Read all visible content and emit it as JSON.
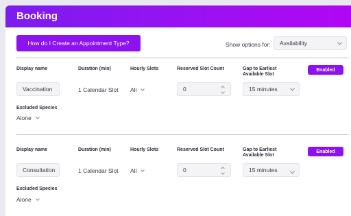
{
  "header": {
    "title": "Booking"
  },
  "toolbar": {
    "help_label": "How do I Create an Appointment Type?",
    "show_options_label": "Show options for:",
    "show_options_value": "Availability"
  },
  "columns": {
    "display_name": "Display name",
    "duration": "Duration (min)",
    "hourly_slots": "Hourly Slots",
    "reserved_slot_count": "Reserved Slot Count",
    "gap_line1": "Gap to Earliest",
    "gap_line2": "Available Slot",
    "excluded_species": "Excluded Species"
  },
  "appointments": [
    {
      "display_name": "Vaccination",
      "duration": "1 Calendar Slot",
      "hourly_slots": "All",
      "reserved_slot_count": "0",
      "gap": "15 minutes",
      "status": "Enabled",
      "excluded_species": "Alone"
    },
    {
      "display_name": "Consultation",
      "duration": "1 Calendar Slot",
      "hourly_slots": "All",
      "reserved_slot_count": "0",
      "gap": "15 minutes",
      "status": "Enabled",
      "excluded_species": "Alone"
    }
  ]
}
